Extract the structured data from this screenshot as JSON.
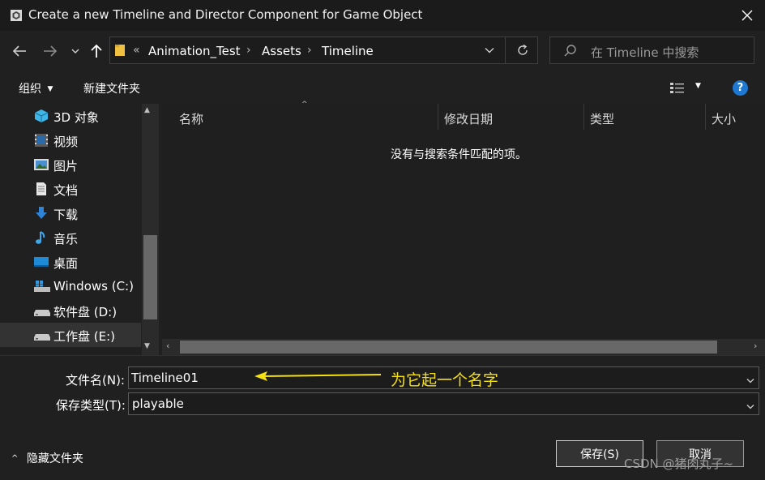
{
  "window": {
    "title": "Create a new Timeline and Director Component for Game Object"
  },
  "address": {
    "overflow": "«",
    "crumbs": [
      "Animation_Test",
      "Assets",
      "Timeline"
    ]
  },
  "search": {
    "placeholder": "在 Timeline 中搜索"
  },
  "toolbar": {
    "organize": "组织",
    "new_folder": "新建文件夹"
  },
  "sidebar": {
    "items": [
      {
        "label": "3D 对象",
        "icon": "cube-icon"
      },
      {
        "label": "视频",
        "icon": "video-icon"
      },
      {
        "label": "图片",
        "icon": "picture-icon"
      },
      {
        "label": "文档",
        "icon": "document-icon"
      },
      {
        "label": "下载",
        "icon": "download-icon"
      },
      {
        "label": "音乐",
        "icon": "music-icon"
      },
      {
        "label": "桌面",
        "icon": "desktop-icon"
      },
      {
        "label": "Windows (C:)",
        "icon": "windows-drive-icon"
      },
      {
        "label": "软件盘 (D:)",
        "icon": "drive-icon"
      },
      {
        "label": "工作盘 (E:)",
        "icon": "drive-icon",
        "selected": true
      }
    ]
  },
  "columns": {
    "name": "名称",
    "modified": "修改日期",
    "type": "类型",
    "size": "大小"
  },
  "content": {
    "empty_message": "没有与搜索条件匹配的项。"
  },
  "form": {
    "filename_label": "文件名(N):",
    "filename_value": "Timeline01",
    "filetype_label": "保存类型(T):",
    "filetype_value": "playable"
  },
  "annotation": {
    "text": "为它起一个名字",
    "color": "#f5e010"
  },
  "footer": {
    "hide_folders": "隐藏文件夹",
    "save": "保存(S)",
    "cancel": "取消"
  },
  "watermark": "CSDN @猪肉丸子~"
}
